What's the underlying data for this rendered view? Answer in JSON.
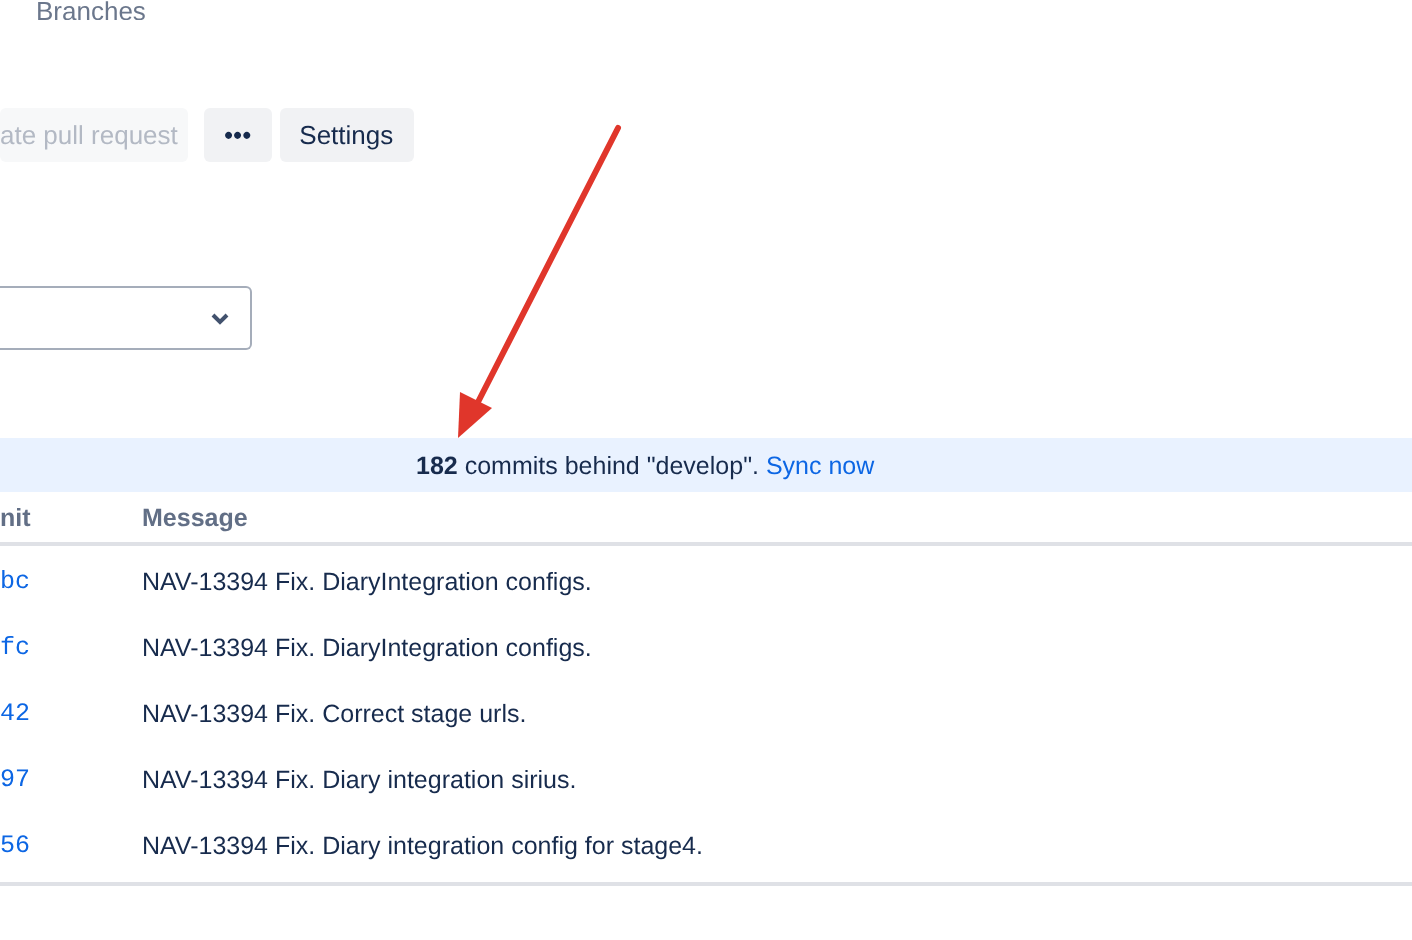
{
  "breadcrumb": {
    "label": "Branches"
  },
  "actions": [
    {
      "label": "ate pull request",
      "disabled": true
    },
    {
      "label": "•••",
      "disabled": false
    },
    {
      "label": "Settings",
      "disabled": false
    }
  ],
  "branch_select": {
    "expanded": false
  },
  "sync_banner": {
    "count": "182",
    "text": "commits behind \"develop\".",
    "link": "Sync now"
  },
  "table": {
    "columns": [
      "nit",
      "Message"
    ],
    "rows": [
      {
        "commit": "bc",
        "message": "NAV-13394 Fix. DiaryIntegration configs."
      },
      {
        "commit": "fc",
        "message": "NAV-13394 Fix. DiaryIntegration configs."
      },
      {
        "commit": "42",
        "message": "NAV-13394 Fix. Correct stage urls."
      },
      {
        "commit": "97",
        "message": "NAV-13394 Fix. Diary integration sirius."
      },
      {
        "commit": "56",
        "message": "NAV-13394 Fix. Diary integration config for stage4."
      }
    ]
  }
}
